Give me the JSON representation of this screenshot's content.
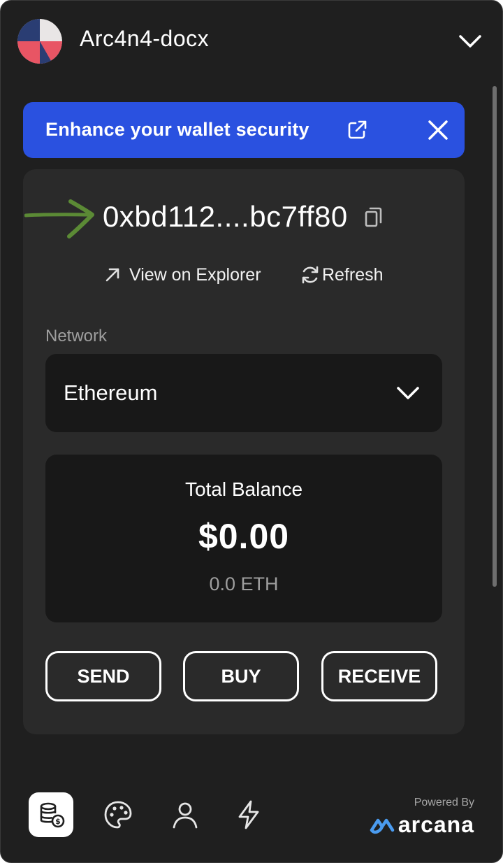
{
  "header": {
    "app_title": "Arc4n4-docx",
    "logo_icon": "app-logo-icon",
    "menu_icon": "chevron-down-icon"
  },
  "banner": {
    "text": "Enhance your wallet security",
    "link_icon": "external-link-icon",
    "close_icon": "close-icon",
    "color": "#2a51e0"
  },
  "wallet": {
    "address": "0xbd112....bc7ff80",
    "copy_icon": "copy-icon",
    "annotation_icon": "arrow-right-icon",
    "annotation_color": "#5b8a35",
    "explorer_label": "View on Explorer",
    "refresh_label": "Refresh"
  },
  "network": {
    "label": "Network",
    "selected": "Ethereum"
  },
  "balance": {
    "label": "Total Balance",
    "usd": "$0.00",
    "eth": "0.0 ETH"
  },
  "actions": {
    "send": "SEND",
    "buy": "BUY",
    "receive": "RECEIVE"
  },
  "footer": {
    "powered_by": "Powered By",
    "brand": "arcana",
    "brand_color": "#4a9bef",
    "nav": [
      "wallet-icon",
      "palette-icon",
      "user-icon",
      "lightning-icon"
    ]
  }
}
